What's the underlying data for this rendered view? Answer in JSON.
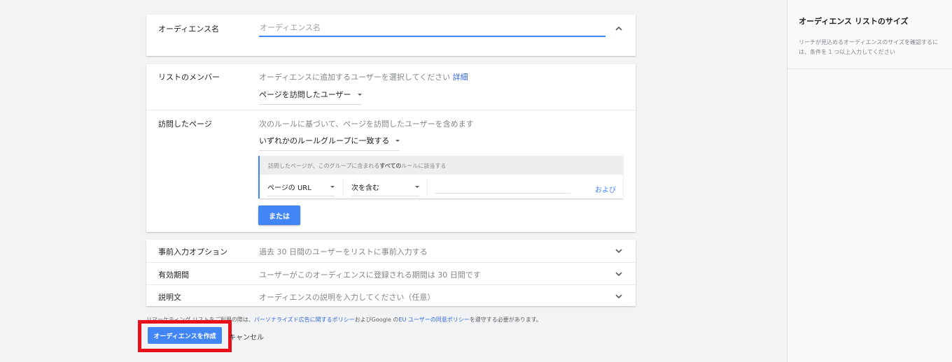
{
  "audience_name": {
    "label": "オーディエンス名",
    "placeholder": "オーディエンス名",
    "value": ""
  },
  "members": {
    "label": "リストのメンバー",
    "hint": "オーディエンスに追加するユーザーを選択してください",
    "hint_link": "詳細",
    "selected": "ページを訪問したユーザー"
  },
  "visited_pages": {
    "label": "訪問したページ",
    "hint": "次のルールに基づいて、ページを訪問したユーザーを含めます",
    "match_selected": "いずれかのルールグループに一致する",
    "group_header_pre": "訪問したページが、このグループに含まれる",
    "group_header_bold": "すべての",
    "group_header_post": "ルールに該当する",
    "rule_field": "ページの URL",
    "rule_operator": "次を含む",
    "rule_value": "",
    "and_label": "および",
    "or_label": "または"
  },
  "collapsed_rows": [
    {
      "label": "事前入力オプション",
      "value": "過去 30 日間のユーザーをリストに事前入力する"
    },
    {
      "label": "有効期間",
      "value": "ユーザーがこのオーディエンスに登録される期間は 30 日間です"
    },
    {
      "label": "説明文",
      "value": "オーディエンスの説明を入力してください（任意）"
    }
  ],
  "policy": {
    "pre": "リマーケティング リストをご利用の際は、",
    "link1": "パーソナライズド広告に関するポリシー",
    "mid": "およびGoogle の",
    "link2": "EU ユーザーの同意ポリシー",
    "post": "を遵守する必要があります。"
  },
  "actions": {
    "create_label": "オーディエンスを作成",
    "cancel_label": "キャンセル"
  },
  "side_panel": {
    "title": "オーディエンス リストのサイズ",
    "description": "リーチが見込めるオーディエンスのサイズを確認するには、条件を 1 つ以上入力してください"
  },
  "colors": {
    "primary": "#4285f4",
    "link": "#3367d6",
    "highlight": "#e8101a"
  }
}
